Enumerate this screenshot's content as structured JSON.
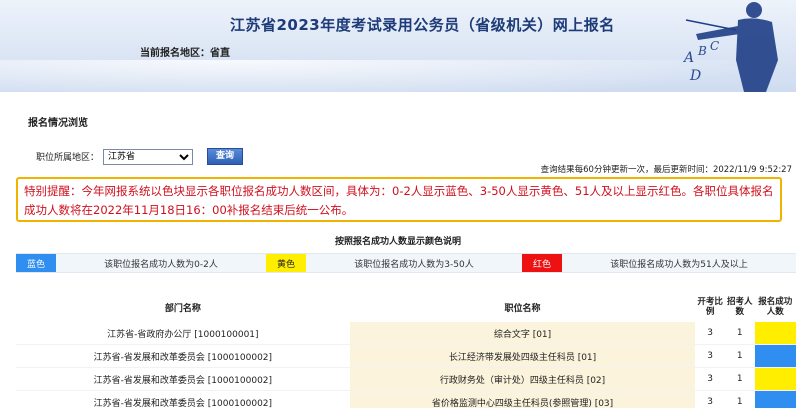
{
  "header": {
    "title": "江苏省2023年度考试录用公务员（省级机关）网上报名",
    "region_label": "当前报名地区：省直",
    "deco_letters": [
      "A",
      "B",
      "C",
      "D"
    ]
  },
  "section": {
    "title": "报名情况浏览",
    "filter_label": "职位所属地区：",
    "filter_value": "江苏省",
    "query_button": "查询",
    "update_note": "查询结果每60分钟更新一次，最后更新时间：2022/11/9 9:52:27"
  },
  "notice": {
    "text": "特别提醒：今年网报系统以色块显示各职位报名成功人数区间，具体为：0-2人显示蓝色、3-50人显示黄色、51人及以上显示红色。各职位具体报名成功人数将在2022年11月18日16：00补报名结束后统一公布。"
  },
  "legend": {
    "title": "按照报名成功人数显示颜色说明",
    "items": [
      {
        "swatch": "蓝色",
        "desc": "该职位报名成功人数为0-2人",
        "color": "#2f8ef0"
      },
      {
        "swatch": "黄色",
        "desc": "该职位报名成功人数为3-50人",
        "color": "#ffee00"
      },
      {
        "swatch": "红色",
        "desc": "该职位报名成功人数为51人及以上",
        "color": "#ee1111"
      }
    ]
  },
  "table": {
    "headers": {
      "dept": "部门名称",
      "job": "职位名称",
      "ratio": "开考比例",
      "num": "招考人数",
      "status": "报名成功人数"
    },
    "rows": [
      {
        "dept": "江苏省-省政府办公厅 [1000100001]",
        "job": "综合文字 [01]",
        "ratio": "3",
        "num": "1",
        "status_color": "#ffee00"
      },
      {
        "dept": "江苏省-省发展和改革委员会 [1000100002]",
        "job": "长江经济带发展处四级主任科员 [01]",
        "ratio": "3",
        "num": "1",
        "status_color": "#2f8ef0"
      },
      {
        "dept": "江苏省-省发展和改革委员会 [1000100002]",
        "job": "行政财务处（审计处）四级主任科员 [02]",
        "ratio": "3",
        "num": "1",
        "status_color": "#ffee00"
      },
      {
        "dept": "江苏省-省发展和改革委员会 [1000100002]",
        "job": "省价格监测中心四级主任科员(参照管理) [03]",
        "ratio": "3",
        "num": "1",
        "status_color": "#2f8ef0"
      }
    ]
  }
}
